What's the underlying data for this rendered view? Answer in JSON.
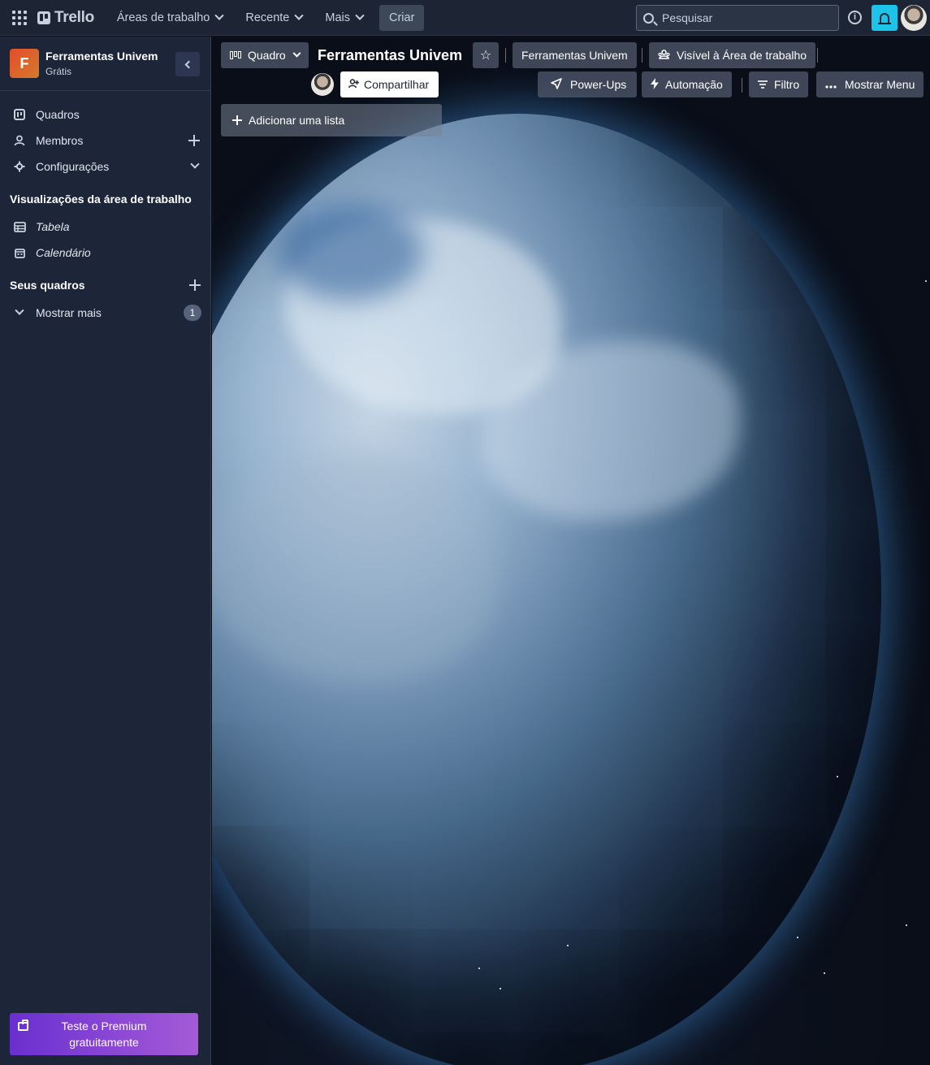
{
  "topnav": {
    "logo": "Trello",
    "workspaces": "Áreas de trabalho",
    "recent": "Recente",
    "more": "Mais",
    "create": "Criar",
    "search_placeholder": "Pesquisar",
    "info_icon": "info-icon",
    "bell_icon": "bell-icon",
    "accent": "#1dc4e9"
  },
  "sidebar": {
    "workspace_initial": "F",
    "workspace_name": "Ferramentas Univem",
    "workspace_plan": "Grátis",
    "items": [
      {
        "label": "Quadros",
        "icon": "board-icon"
      },
      {
        "label": "Membros",
        "icon": "person-icon"
      },
      {
        "label": "Configurações",
        "icon": "gear-icon"
      }
    ],
    "views_title": "Visualizações da área de trabalho",
    "views": [
      {
        "label": "Tabela",
        "icon": "table-icon"
      },
      {
        "label": "Calendário",
        "icon": "calendar-icon"
      }
    ],
    "boards_title": "Seus quadros",
    "show_more": "Mostrar mais",
    "show_more_count": "1",
    "premium_line1": "Teste o Premium",
    "premium_line2": "gratuitamente"
  },
  "board": {
    "view_switch": "Quadro",
    "title": "Ferramentas Univem",
    "workspace_button": "Ferramentas Univem",
    "visibility": "Visível à Área de trabalho",
    "share": "Compartilhar",
    "powerups": "Power-Ups",
    "automation": "Automação",
    "filter": "Filtro",
    "menu": "Mostrar Menu",
    "add_list": "Adicionar uma lista"
  }
}
